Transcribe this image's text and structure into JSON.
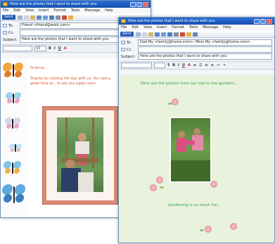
{
  "window_back": {
    "title": "Here are the photos that I want to share with you",
    "menu": [
      "File",
      "Edit",
      "View",
      "Insert",
      "Format",
      "Tools",
      "Message",
      "Help"
    ],
    "send_label": "Send",
    "to_label": "To:",
    "to_value": "Friend <friend@work.com>",
    "cc_label": "Cc:",
    "subject_label": "Subject:",
    "subject_value": "Here are the photos that I want to share with you",
    "body_greeting": "Hi Anna,",
    "body_text": "Thanks for visiting the day with us. You had a great time w... to see you again soon.",
    "font_size": "10"
  },
  "window_front": {
    "title": "Here are the photos that I want to share with you",
    "menu": [
      "File",
      "Edit",
      "View",
      "Insert",
      "Format",
      "Tools",
      "Message",
      "Help"
    ],
    "send_label": "Send",
    "to_label": "To:",
    "to_value": "Dad My <family@home.com>; Mom My <family@home.com>",
    "cc_label": "Cc:",
    "subject_label": "Subject:",
    "subject_value": "Here are the photos that I want to share with you",
    "body_heading": "Here are the photos from our trip to the gardens...",
    "body_footer": "Gardening is so much fun..."
  },
  "colors": {
    "title_bar": "#1d5fc8",
    "back_body_text": "#d4572a",
    "front_body_text": "#3aa34a",
    "stationery_bg": "#e8f2dc",
    "photo_frame_border": "#d98a72"
  }
}
